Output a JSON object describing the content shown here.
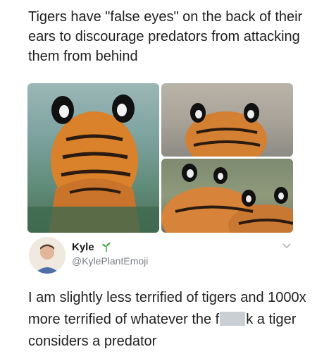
{
  "caption": "Tigers have \"false eyes\" on the back of their ears to discourage predators from attacking them from behind",
  "photos": [
    {
      "name": "tiger-in-water-photo"
    },
    {
      "name": "tiger-ears-rocks-photo"
    },
    {
      "name": "tigers-ears-closeup-photo"
    }
  ],
  "tweet": {
    "display_name": "Kyle",
    "name_emoji": "sprout-icon",
    "handle": "@KylePlantEmoji",
    "menu_icon": "chevron-down-icon",
    "text_before": "I am slightly less terrified of tigers and 1000x more terrified of whatever the f",
    "text_after": "k a tiger considers a predator"
  },
  "colors": {
    "text": "#1f1f1f",
    "handle": "#7a8087",
    "sprout": "#4aa84a"
  }
}
